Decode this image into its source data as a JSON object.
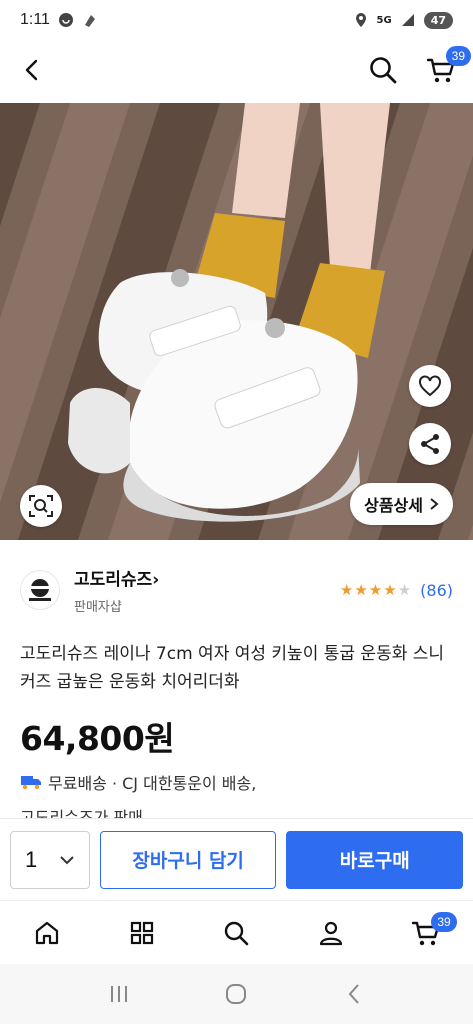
{
  "status_bar": {
    "time": "1:11",
    "network": "5G",
    "battery": "47"
  },
  "header": {
    "cart_count": "39"
  },
  "colors": {
    "accent": "#2e6cf0",
    "star": "#f29a2e"
  },
  "product_image": {
    "detail_button_label": "상품상세"
  },
  "seller": {
    "name": "고도리슈즈",
    "subtitle": "판매자샵",
    "review_count": "(86)",
    "stars": 4
  },
  "product": {
    "title": "고도리슈즈 레이나 7cm 여자 여성 키높이 통굽 운동화 스니커즈 굽높은 운동화 치어리더화",
    "price": "64,800원",
    "shipping": "무료배송 · CJ 대한통운이 배송,",
    "sold_by": "고도리슈즈가 판매"
  },
  "buy_bar": {
    "quantity": "1",
    "cart_label": "장바구니 담기",
    "buy_label": "바로구매"
  },
  "tab_bar": {
    "cart_count": "39"
  },
  "icons": [
    "back-icon",
    "search-icon",
    "cart-icon",
    "heart-icon",
    "share-icon",
    "lens-icon",
    "chevron-right-icon",
    "truck-icon",
    "chevron-down-icon",
    "home-icon",
    "grid-icon",
    "user-icon",
    "recents-icon",
    "home-circle-icon",
    "back-triangle-icon"
  ]
}
